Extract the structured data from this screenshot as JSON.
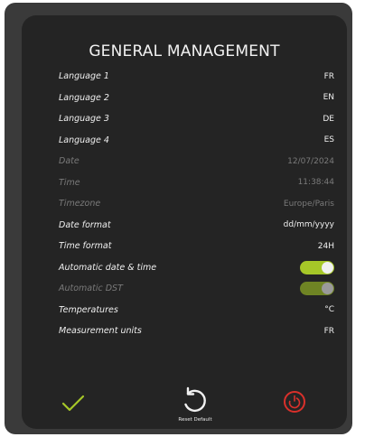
{
  "title": "GENERAL MANAGEMENT",
  "settings": [
    {
      "label": "Language 1",
      "value": "FR",
      "disabled": false
    },
    {
      "label": "Language 2",
      "value": "EN",
      "disabled": false
    },
    {
      "label": "Language 3",
      "value": "DE",
      "disabled": false
    },
    {
      "label": "Language 4",
      "value": "ES",
      "disabled": false
    },
    {
      "label": "Date",
      "value": "12/07/2024",
      "disabled": true
    },
    {
      "label": "Time",
      "value": "11:38:44",
      "disabled": true
    },
    {
      "label": "Timezone",
      "value": "Europe/Paris",
      "disabled": true
    },
    {
      "label": "Date format",
      "value": "dd/mm/yyyy",
      "disabled": false
    },
    {
      "label": "Time format",
      "value": "24H",
      "disabled": false
    },
    {
      "label": "Automatic date & time",
      "toggle": true,
      "on": true,
      "disabled": false
    },
    {
      "label": "Automatic DST",
      "toggle": true,
      "on": true,
      "disabled": true
    },
    {
      "label": "Temperatures",
      "value": "°C",
      "disabled": false
    },
    {
      "label": "Measurement units",
      "value": "FR",
      "disabled": false
    }
  ],
  "actions": {
    "confirm_icon": "check-icon",
    "reset_icon": "rotate-ccw-icon",
    "reset_label": "Reset Default",
    "power_icon": "power-icon"
  },
  "colors": {
    "accent_green": "#a6c728",
    "accent_green_dim": "#6f8424",
    "danger_red": "#d9302b",
    "background": "#242424"
  }
}
